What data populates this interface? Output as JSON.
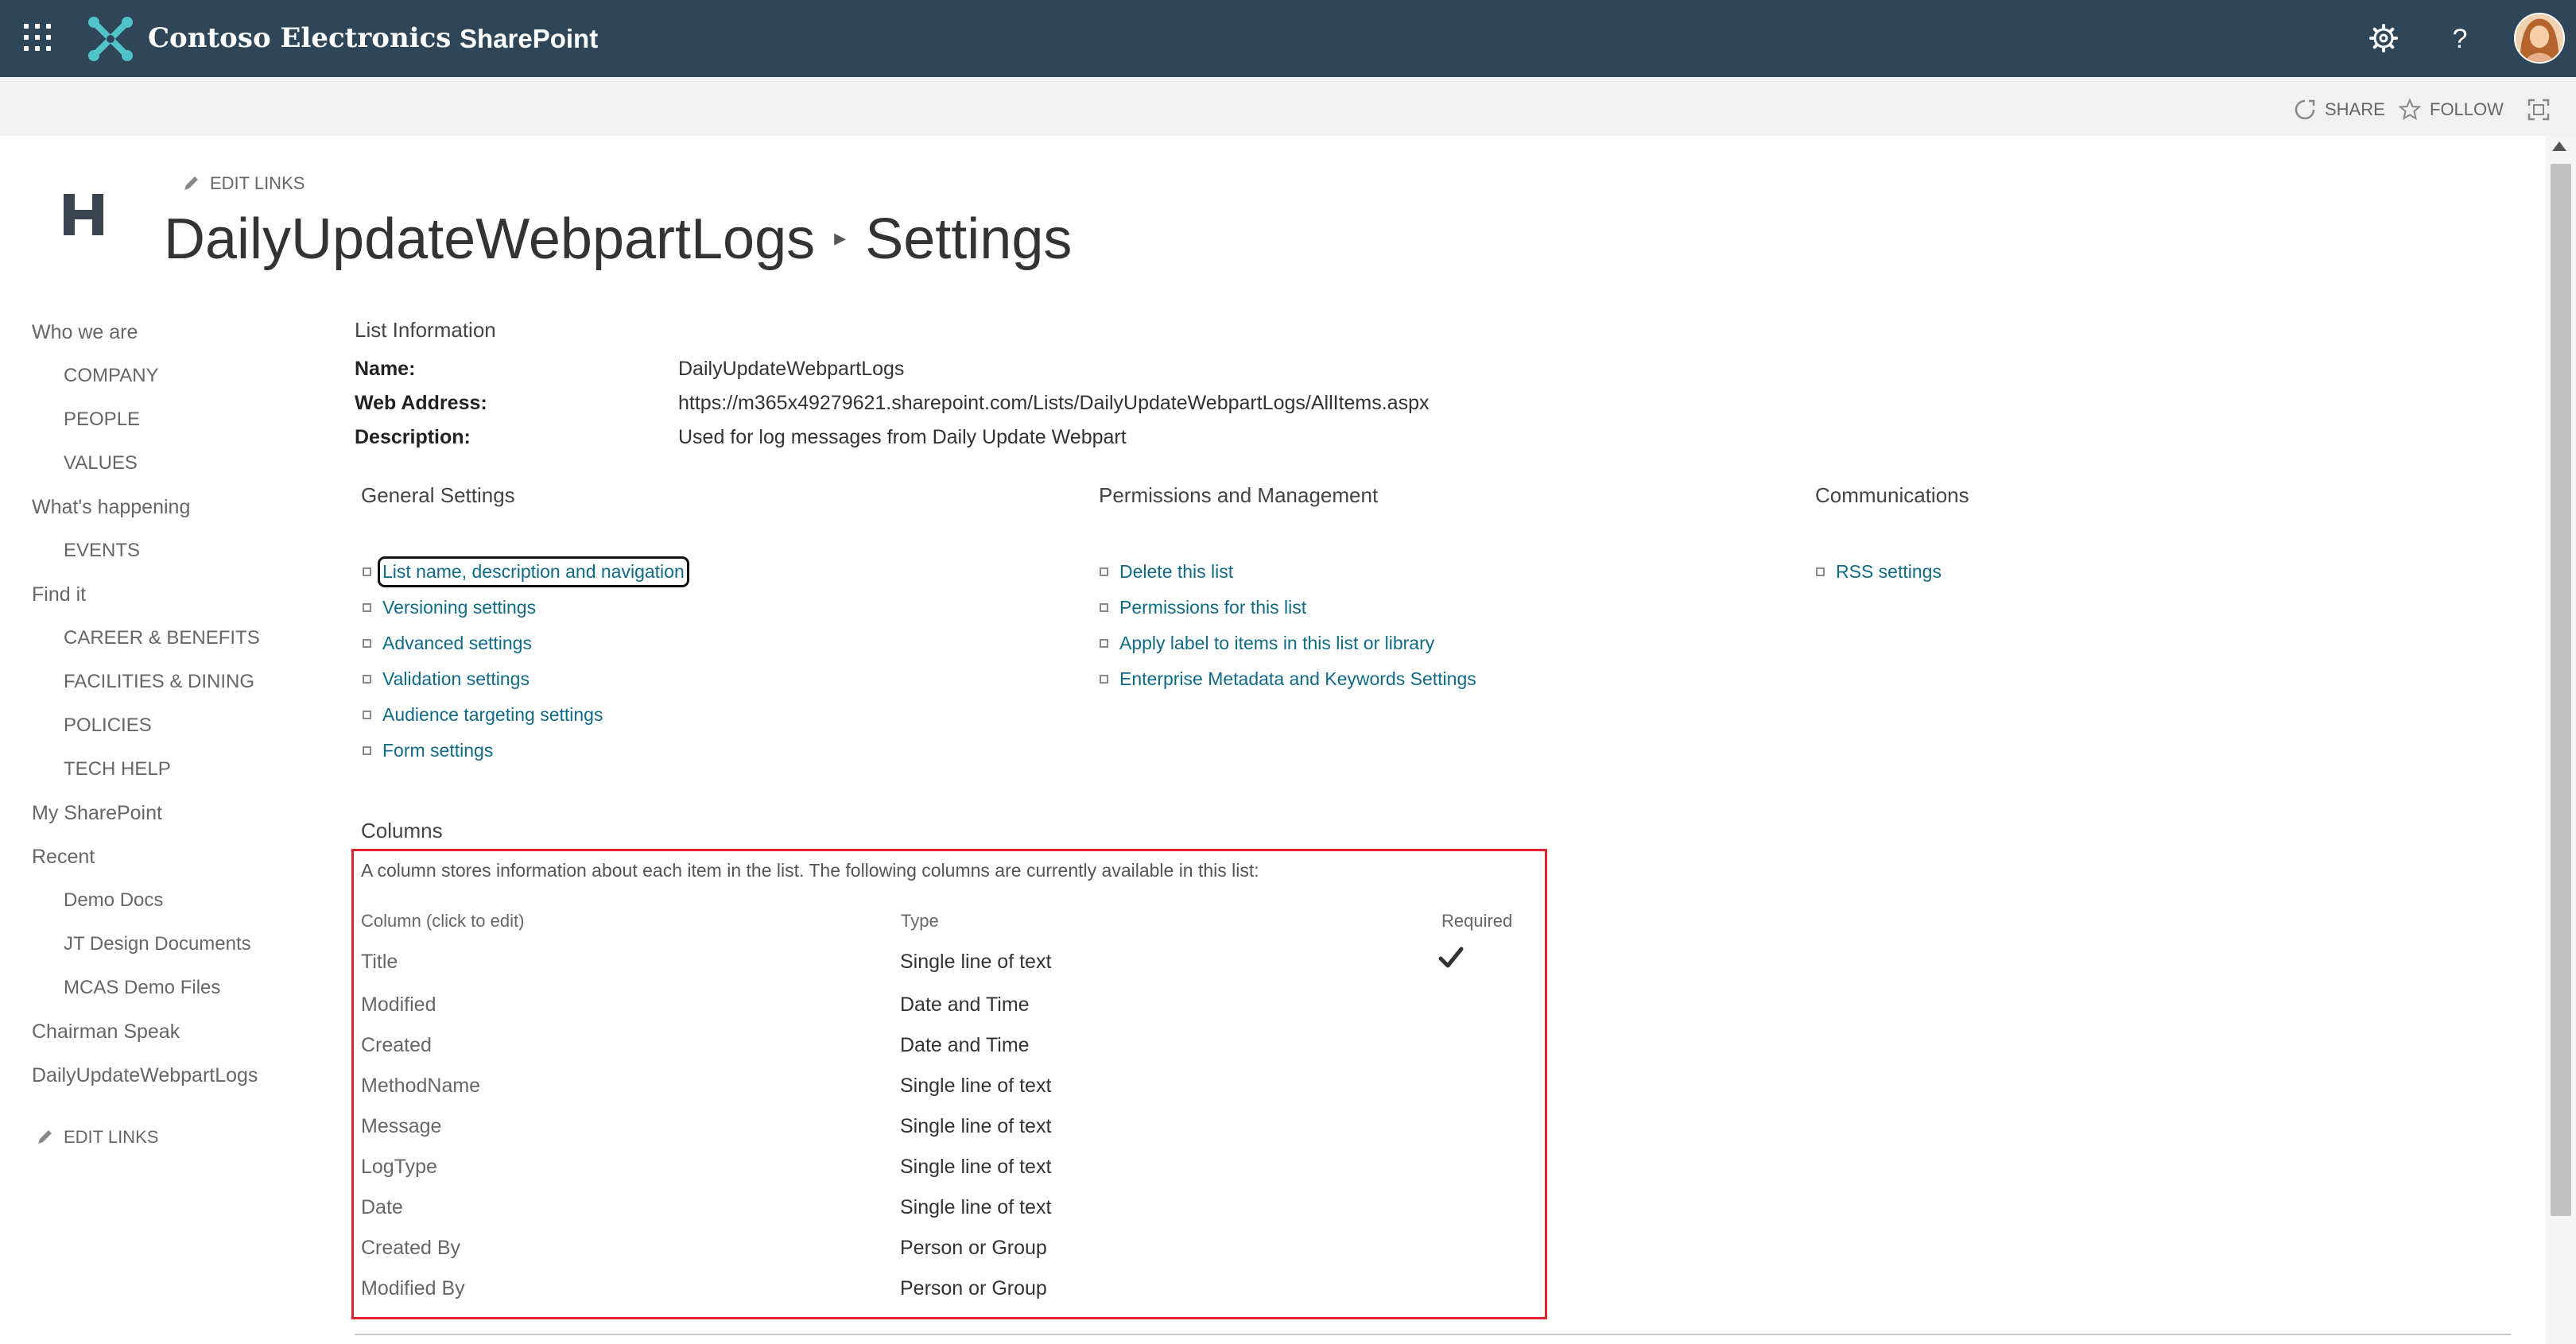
{
  "suitebar": {
    "brand": "Contoso Electronics",
    "app": "SharePoint",
    "icons": [
      "app-launcher-icon",
      "settings-icon",
      "help-icon",
      "avatar"
    ]
  },
  "ribbon": {
    "share": "SHARE",
    "follow": "FOLLOW",
    "icons": [
      "share-icon",
      "star-icon",
      "focus-mode-icon"
    ]
  },
  "header": {
    "edit_links": "EDIT LINKS",
    "breadcrumb_list": "DailyUpdateWebpartLogs",
    "breadcrumb_sep": "▸",
    "breadcrumb_page": "Settings"
  },
  "leftnav": {
    "items": [
      {
        "label": "Who we are",
        "level": 0
      },
      {
        "label": "COMPANY",
        "level": 1
      },
      {
        "label": "PEOPLE",
        "level": 1
      },
      {
        "label": "VALUES",
        "level": 1
      },
      {
        "label": "What's happening",
        "level": 0
      },
      {
        "label": "EVENTS",
        "level": 1
      },
      {
        "label": "Find it",
        "level": 0
      },
      {
        "label": "CAREER & BENEFITS",
        "level": 1
      },
      {
        "label": "FACILITIES & DINING",
        "level": 1
      },
      {
        "label": "POLICIES",
        "level": 1
      },
      {
        "label": "TECH HELP",
        "level": 1
      },
      {
        "label": "My SharePoint",
        "level": 0
      },
      {
        "label": "Recent",
        "level": 0
      },
      {
        "label": "Demo Docs",
        "level": 1
      },
      {
        "label": "JT Design Documents",
        "level": 1
      },
      {
        "label": "MCAS Demo Files",
        "level": 1
      },
      {
        "label": "Chairman Speak",
        "level": 0
      },
      {
        "label": "DailyUpdateWebpartLogs",
        "level": 0
      }
    ],
    "edit_links": "EDIT LINKS"
  },
  "list_info": {
    "title": "List Information",
    "name_label": "Name:",
    "name_value": "DailyUpdateWebpartLogs",
    "web_label": "Web Address:",
    "web_value": "https://m365x49279621.sharepoint.com/Lists/DailyUpdateWebpartLogs/AllItems.aspx",
    "desc_label": "Description:",
    "desc_value": "Used for log messages from Daily Update Webpart"
  },
  "general": {
    "title": "General Settings",
    "links": [
      "List name, description and navigation",
      "Versioning settings",
      "Advanced settings",
      "Validation settings",
      "Audience targeting settings",
      "Form settings"
    ]
  },
  "permissions": {
    "title": "Permissions and Management",
    "links": [
      "Delete this list",
      "Permissions for this list",
      "Apply label to items in this list or library",
      "Enterprise Metadata and Keywords Settings"
    ]
  },
  "communications": {
    "title": "Communications",
    "links": [
      "RSS settings"
    ]
  },
  "columns": {
    "title": "Columns",
    "description": "A column stores information about each item in the list. The following columns are currently available in this list:",
    "headers": {
      "name": "Column (click to edit)",
      "type": "Type",
      "required": "Required"
    },
    "rows": [
      {
        "name": "Title",
        "type": "Single line of text",
        "required": true
      },
      {
        "name": "Modified",
        "type": "Date and Time",
        "required": false
      },
      {
        "name": "Created",
        "type": "Date and Time",
        "required": false
      },
      {
        "name": "MethodName",
        "type": "Single line of text",
        "required": false
      },
      {
        "name": "Message",
        "type": "Single line of text",
        "required": false
      },
      {
        "name": "LogType",
        "type": "Single line of text",
        "required": false
      },
      {
        "name": "Date",
        "type": "Single line of text",
        "required": false
      },
      {
        "name": "Created By",
        "type": "Person or Group",
        "required": false
      },
      {
        "name": "Modified By",
        "type": "Person or Group",
        "required": false
      }
    ]
  },
  "colors": {
    "suitebar": "#2f4558",
    "link": "#0f6a88",
    "highlight_box": "#e0232f"
  }
}
